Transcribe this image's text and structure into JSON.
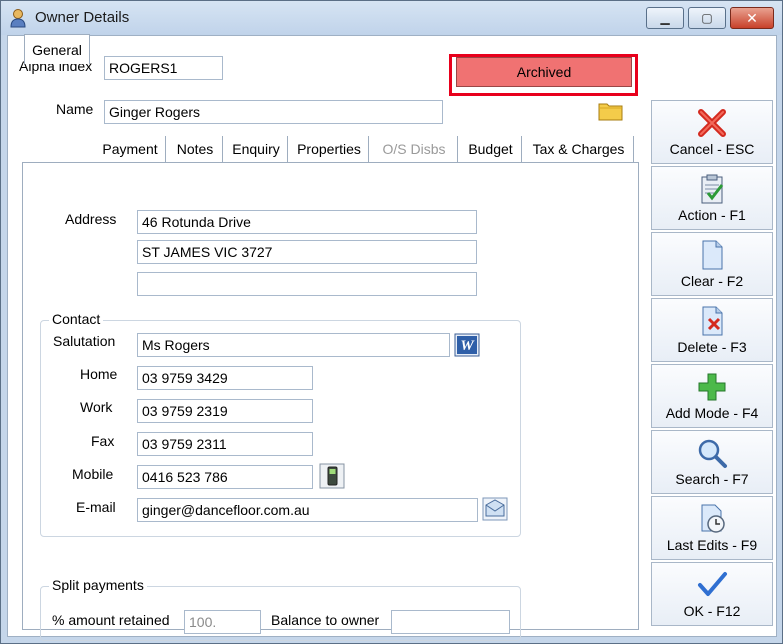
{
  "window": {
    "title": "Owner Details"
  },
  "alpha_index": {
    "label": "Alpha index",
    "value": "ROGERS1"
  },
  "status": {
    "label": "Archived",
    "color": "#f07272"
  },
  "name": {
    "label": "Name",
    "value": "Ginger Rogers"
  },
  "tabs": [
    {
      "label": "General",
      "state": "active"
    },
    {
      "label": "Payment",
      "state": "normal"
    },
    {
      "label": "Notes",
      "state": "normal"
    },
    {
      "label": "Enquiry",
      "state": "normal"
    },
    {
      "label": "Properties",
      "state": "normal"
    },
    {
      "label": "O/S Disbs",
      "state": "disabled"
    },
    {
      "label": "Budget",
      "state": "normal"
    },
    {
      "label": "Tax & Charges",
      "state": "normal"
    }
  ],
  "address": {
    "label": "Address",
    "line1": "46 Rotunda Drive",
    "line2": "ST JAMES    VIC   3727",
    "line3": ""
  },
  "contact": {
    "title": "Contact",
    "salutation": {
      "label": "Salutation",
      "value": "Ms Rogers"
    },
    "home": {
      "label": "Home",
      "value": "03 9759 3429"
    },
    "work": {
      "label": "Work",
      "value": "03 9759 2319"
    },
    "fax": {
      "label": "Fax",
      "value": "03 9759 2311"
    },
    "mobile": {
      "label": "Mobile",
      "value": "0416 523 786"
    },
    "email": {
      "label": "E-mail",
      "value": "ginger@dancefloor.com.au"
    }
  },
  "split_payments": {
    "title": "Split payments",
    "retained_label": "% amount retained",
    "retained_value": "100.",
    "balance_label": "Balance to owner",
    "balance_value": ""
  },
  "sidebar": [
    {
      "label": "Cancel - ESC",
      "icon": "cancel-x-icon"
    },
    {
      "label": "Action - F1",
      "icon": "action-clipboard-icon"
    },
    {
      "label": "Clear - F2",
      "icon": "clear-document-icon"
    },
    {
      "label": "Delete - F3",
      "icon": "delete-document-icon"
    },
    {
      "label": "Add Mode - F4",
      "icon": "add-plus-icon"
    },
    {
      "label": "Search - F7",
      "icon": "search-magnifier-icon"
    },
    {
      "label": "Last Edits - F9",
      "icon": "last-edits-clock-icon"
    },
    {
      "label": "OK - F12",
      "icon": "ok-checkmark-icon"
    }
  ],
  "colors": {
    "window_frame": "#c5d6ea",
    "archived_highlight": "#e8001c",
    "close_button": "#c8412a"
  }
}
